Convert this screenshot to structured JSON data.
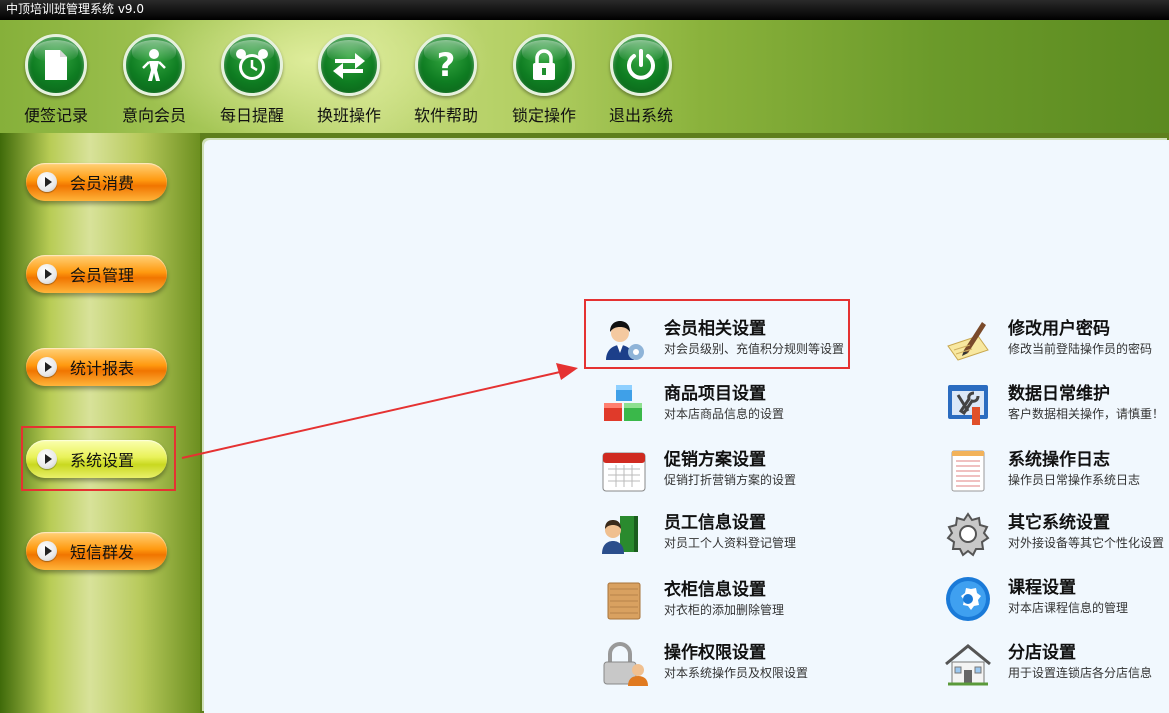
{
  "window": {
    "title": "中顶培训班管理系统  v9.0"
  },
  "toolbar": {
    "items": [
      {
        "label": "便签记录",
        "icon": "note-icon"
      },
      {
        "label": "意向会员",
        "icon": "person-icon"
      },
      {
        "label": "每日提醒",
        "icon": "alarm-clock-icon"
      },
      {
        "label": "换班操作",
        "icon": "swap-arrows-icon"
      },
      {
        "label": "软件帮助",
        "icon": "help-icon"
      },
      {
        "label": "锁定操作",
        "icon": "lock-icon"
      },
      {
        "label": "退出系统",
        "icon": "power-icon"
      }
    ]
  },
  "sidebar": {
    "items": [
      {
        "label": "会员消费",
        "active": false
      },
      {
        "label": "会员管理",
        "active": false
      },
      {
        "label": "统计报表",
        "active": false
      },
      {
        "label": "系统设置",
        "active": true
      },
      {
        "label": "短信群发",
        "active": false
      }
    ]
  },
  "settings": {
    "left": [
      {
        "title": "会员相关设置",
        "desc": "对会员级别、充值积分规则等设置",
        "icon": "member-settings-icon"
      },
      {
        "title": "商品项目设置",
        "desc": "对本店商品信息的设置",
        "icon": "cubes-icon"
      },
      {
        "title": "促销方案设置",
        "desc": "促销打折营销方案的设置",
        "icon": "calendar-icon"
      },
      {
        "title": "员工信息设置",
        "desc": "对员工个人资料登记管理",
        "icon": "staff-book-icon"
      },
      {
        "title": "衣柜信息设置",
        "desc": "对衣柜的添加删除管理",
        "icon": "wardrobe-icon"
      },
      {
        "title": "操作权限设置",
        "desc": "对本系统操作员及权限设置",
        "icon": "permission-lock-icon"
      }
    ],
    "right": [
      {
        "title": "修改用户密码",
        "desc": "修改当前登陆操作员的密码",
        "icon": "pen-paper-icon"
      },
      {
        "title": "数据日常维护",
        "desc": "客户数据相关操作，请慎重！",
        "icon": "maintenance-tools-icon"
      },
      {
        "title": "系统操作日志",
        "desc": "操作员日常操作系统日志",
        "icon": "log-notepad-icon"
      },
      {
        "title": "其它系统设置",
        "desc": "对外接设备等其它个性化设置",
        "icon": "gear-icon"
      },
      {
        "title": "课程设置",
        "desc": "对本店课程信息的管理",
        "icon": "course-settings-icon"
      },
      {
        "title": "分店设置",
        "desc": "用于设置连锁店各分店信息",
        "icon": "house-icon"
      }
    ]
  },
  "colors": {
    "highlight_box": "#e53232",
    "panel_bg": "#f1f8fe",
    "button_orange": "#ff9a10",
    "button_active": "#e9f25a"
  }
}
